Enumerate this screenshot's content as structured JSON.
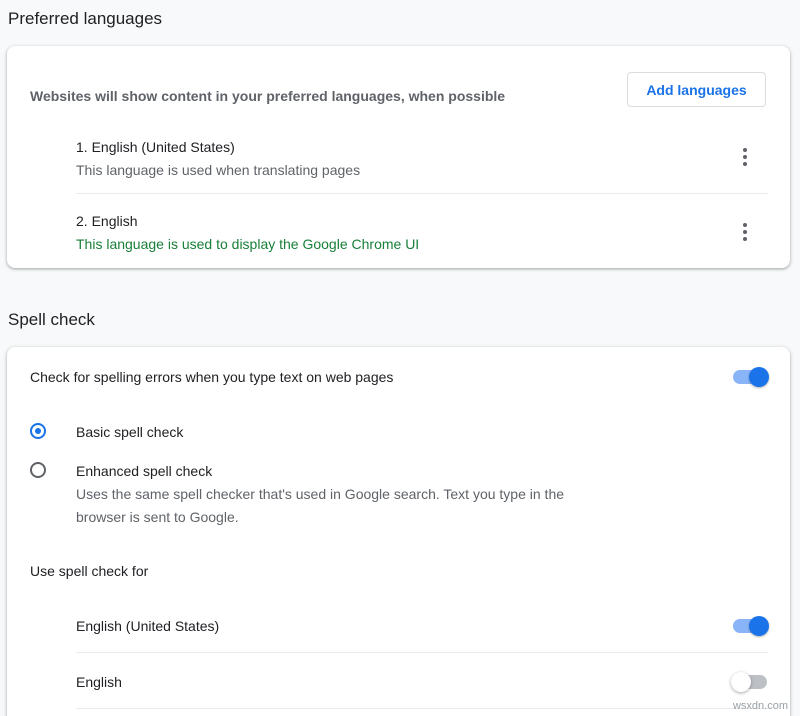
{
  "preferred_languages": {
    "title": "Preferred languages",
    "description": "Websites will show content in your preferred languages, when possible",
    "add_button_label": "Add languages",
    "languages": [
      {
        "name": "1. English (United States)",
        "subtext": "This language is used when translating pages"
      },
      {
        "name": "2. English",
        "subtext": "This language is used to display the Google Chrome UI"
      }
    ]
  },
  "spell_check": {
    "title": "Spell check",
    "main_toggle_label": "Check for spelling errors when you type text on web pages",
    "main_toggle_on": true,
    "options": [
      {
        "label": "Basic spell check",
        "checked": true
      },
      {
        "label": "Enhanced spell check",
        "checked": false,
        "description_line1": "Uses the same spell checker that's used in Google search. Text you type in the",
        "description_line2": "browser is sent to Google."
      }
    ],
    "use_for_label": "Use spell check for",
    "use_for_items": [
      {
        "label": "English (United States)",
        "on": true
      },
      {
        "label": "English",
        "on": false
      }
    ]
  },
  "watermark": "wsxdn.com",
  "colors": {
    "accent": "#1a73e8",
    "green_text": "#188038",
    "secondary_text": "#5f6368"
  }
}
